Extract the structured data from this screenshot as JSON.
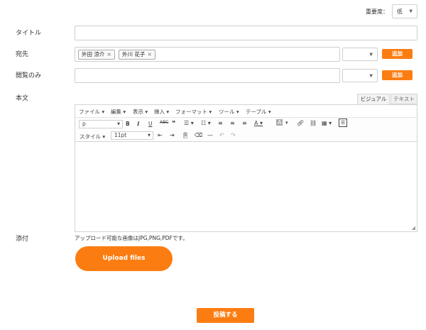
{
  "priority": {
    "label": "重要度：",
    "value": "低"
  },
  "fields": {
    "title_label": "タイトル",
    "to_label": "宛先",
    "cc_label": "閲覧のみ",
    "body_label": "本文",
    "attach_label": "添付"
  },
  "recipients": [
    "外田 涼介",
    "外川 花子"
  ],
  "add_button": "追加",
  "editor": {
    "tabs": [
      "ビジュアル",
      "テキスト"
    ],
    "menus": [
      "ファイル ▾",
      "編集 ▾",
      "表示 ▾",
      "挿入 ▾",
      "フォーマット ▾",
      "ツール ▾",
      "テーブル ▾"
    ],
    "format_value": "p",
    "style_label": "スタイル ▾",
    "font_size_value": "11pt"
  },
  "attach_note": "アップロード可能な画像はJPG,PNG,PDFです。",
  "upload_button": "Upload files",
  "submit_button": "投稿する",
  "colors": {
    "accent": "#fb7d12"
  }
}
